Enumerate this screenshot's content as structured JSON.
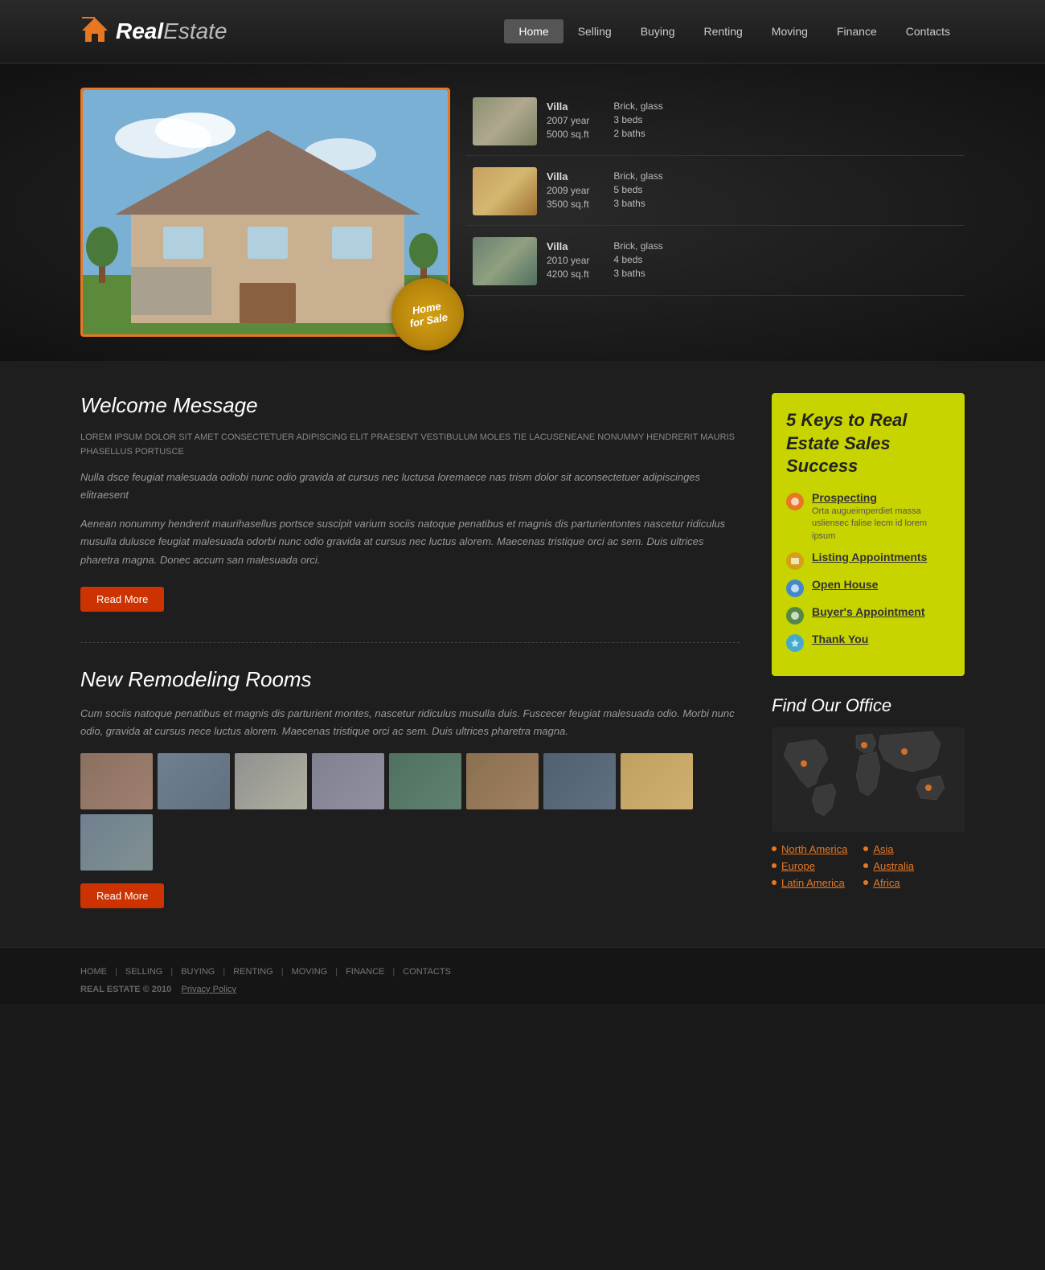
{
  "header": {
    "logo_real": "Real",
    "logo_estate": "Estate",
    "nav": [
      {
        "label": "Home",
        "active": true
      },
      {
        "label": "Selling",
        "active": false
      },
      {
        "label": "Buying",
        "active": false
      },
      {
        "label": "Renting",
        "active": false
      },
      {
        "label": "Moving",
        "active": false
      },
      {
        "label": "Finance",
        "active": false
      },
      {
        "label": "Contacts",
        "active": false
      }
    ]
  },
  "hero": {
    "badge_line1": "Home",
    "badge_line2": "for Sale"
  },
  "properties": [
    {
      "name": "Villa",
      "year": "2007 year",
      "sqft": "5000 sq.ft",
      "material": "Brick, glass",
      "beds": "3 beds",
      "baths": "2 baths",
      "thumb_class": "prop-thumb-1"
    },
    {
      "name": "Villa",
      "year": "2009 year",
      "sqft": "3500 sq.ft",
      "material": "Brick, glass",
      "beds": "5 beds",
      "baths": "3 baths",
      "thumb_class": "prop-thumb-2"
    },
    {
      "name": "Villa",
      "year": "2010 year",
      "sqft": "4200 sq.ft",
      "material": "Brick, glass",
      "beds": "4 beds",
      "baths": "3 baths",
      "thumb_class": "prop-thumb-3"
    }
  ],
  "welcome": {
    "title": "Welcome Message",
    "text_upper": "LOREM IPSUM DOLOR SIT AMET CONSECTETUER ADIPISCING ELIT PRAESENT VESTIBULUM MOLES TIE LACUSENEANE NONUMMY HENDRERIT MAURIS PHASELLUS PORTUSCE",
    "text1": "Nulla dsce feugiat malesuada odiobi nunc odio gravida at cursus nec luctusa loremaece nas trism dolor sit aconsectetuer adipiscinges elitraesent",
    "text2": "Aenean nonummy hendrerit maurihasellus portsce suscipit varium sociis natoque penatibus et magnis dis parturientontes nascetur ridiculus musulla dulusce feugiat malesuada odorbi nunc odio gravida at cursus nec luctus alorem. Maecenas tristique orci ac sem. Duis ultrices pharetra magna. Donec accum san malesuada orci.",
    "read_more": "Read More"
  },
  "remodeling": {
    "title": "New Remodeling Rooms",
    "text": "Cum sociis natoque penatibus et magnis dis parturient montes, nascetur ridiculus musulla duis. Fuscecer feugiat malesuada odio. Morbi nunc odio, gravida at cursus nece luctus alorem. Maecenas tristique orci ac sem. Duis ultrices pharetra magna.",
    "read_more": "Read More",
    "gallery": [
      {
        "class": "gt1"
      },
      {
        "class": "gt2"
      },
      {
        "class": "gt3"
      },
      {
        "class": "gt4"
      },
      {
        "class": "gt5"
      },
      {
        "class": "gt6"
      },
      {
        "class": "gt7"
      },
      {
        "class": "gt8"
      },
      {
        "class": "gt9"
      }
    ]
  },
  "keys": {
    "title": "5 Keys to Real Estate Sales Success",
    "items": [
      {
        "label": "Prospecting",
        "desc": "Orta augueimperdiet massa usliensec falise lecm id lorem ipsum",
        "icon_class": "icon-orange"
      },
      {
        "label": "Listing Appointments",
        "desc": "",
        "icon_class": "icon-yellow"
      },
      {
        "label": "Open House",
        "desc": "",
        "icon_class": "icon-blue"
      },
      {
        "label": "Buyer's Appointment",
        "desc": "",
        "icon_class": "icon-green-icon"
      },
      {
        "label": "Thank You",
        "desc": "",
        "icon_class": "icon-teal"
      }
    ]
  },
  "find_office": {
    "title": "Find Our Office",
    "locations_col1": [
      {
        "label": "North America"
      },
      {
        "label": "Europe"
      },
      {
        "label": "Latin America"
      }
    ],
    "locations_col2": [
      {
        "label": "Asia"
      },
      {
        "label": "Australia"
      },
      {
        "label": "Africa"
      }
    ]
  },
  "footer": {
    "links": [
      "HOME",
      "SELLING",
      "BUYING",
      "RENTING",
      "MOVING",
      "FINANCE",
      "CONTACTS"
    ],
    "copyright": "REAL ESTATE",
    "year": "© 2010",
    "privacy": "Privacy Policy"
  }
}
